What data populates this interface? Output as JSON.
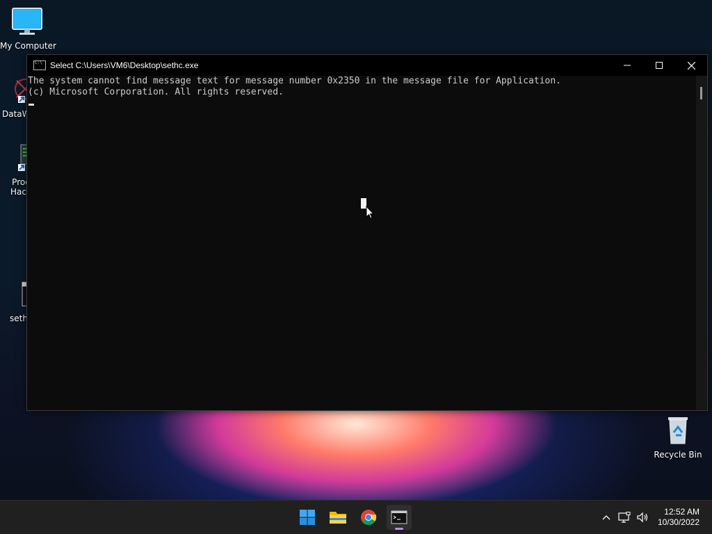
{
  "desktop": {
    "icons": [
      {
        "label": "My Computer"
      },
      {
        "label": "DataW"
      },
      {
        "label": "Proc Hack"
      },
      {
        "label": "sethc"
      },
      {
        "label": "Recycle Bin"
      }
    ]
  },
  "window": {
    "title": "Select C:\\Users\\VM6\\Desktop\\sethc.exe",
    "controls": {
      "minimize": "minimize",
      "maximize": "maximize",
      "close": "close"
    },
    "console_lines": [
      "The system cannot find message text for message number 0x2350 in the message file for Application.",
      "",
      "(c) Microsoft Corporation. All rights reserved."
    ]
  },
  "taskbar": {
    "apps": [
      {
        "name": "start-icon"
      },
      {
        "name": "file-explorer-icon"
      },
      {
        "name": "chrome-icon"
      },
      {
        "name": "command-prompt-icon"
      }
    ],
    "clock": {
      "time": "12:52 AM",
      "date": "10/30/2022"
    }
  },
  "colors": {
    "accent": "#c58ae0",
    "console_bg": "#0c0c0c",
    "console_fg": "#cccccc"
  }
}
